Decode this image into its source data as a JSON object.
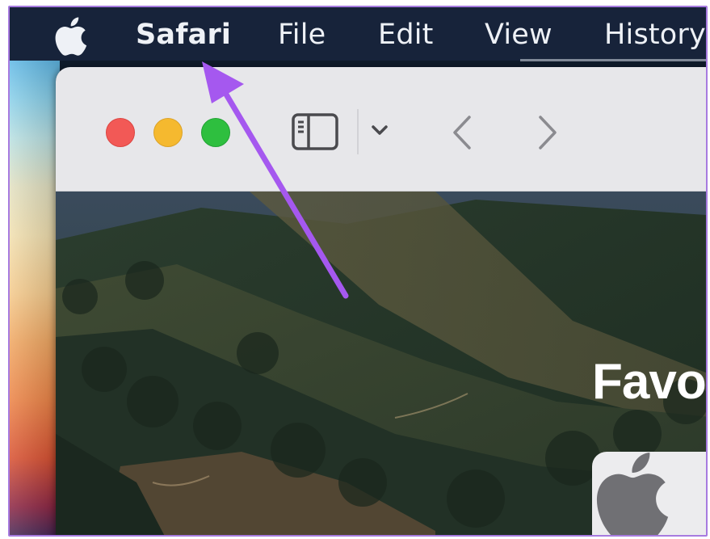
{
  "menubar": {
    "app_name": "Safari",
    "items": [
      "File",
      "Edit",
      "View",
      "History"
    ],
    "apple_icon": "apple-logo-icon"
  },
  "toolbar": {
    "buttons": {
      "close": "close-window-button",
      "minimize": "minimize-window-button",
      "zoom": "zoom-window-button",
      "sidebar": "sidebar-icon",
      "tab_menu": "chevron-down-icon",
      "back": "chevron-left-icon",
      "forward": "chevron-right-icon"
    }
  },
  "start_page": {
    "section_title": "Favo",
    "tile_icon": "apple-logo-icon"
  },
  "colors": {
    "menubar": "#17233a",
    "close": "#f25956",
    "minimize": "#f5b92f",
    "zoom": "#2ebf3f",
    "annotation_arrow": "#a558ef",
    "frame_border": "#a77be0"
  }
}
